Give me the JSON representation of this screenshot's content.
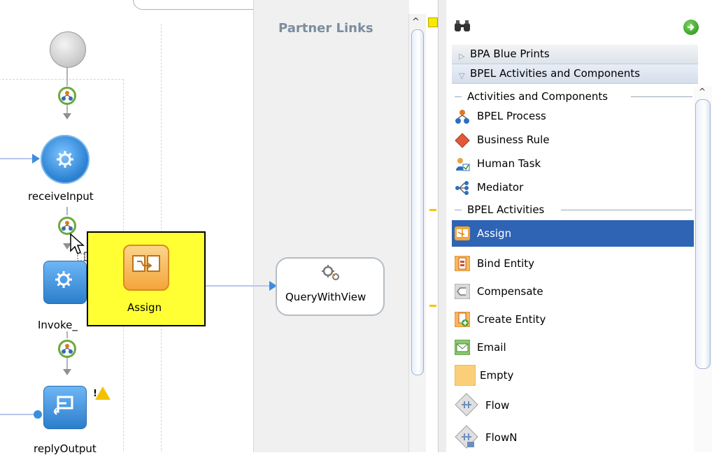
{
  "canvas": {
    "partner_links_title": "Partner Links",
    "nodes": {
      "receive_label": "receiveInput",
      "invoke_label": "Invoke_",
      "reply_label": "replyOutput",
      "query_label": "QueryWithView"
    },
    "drag_tooltip": {
      "label": "Assign"
    },
    "warning_mark": "!"
  },
  "palette": {
    "search": {
      "value": "",
      "placeholder": ""
    },
    "categories": [
      {
        "label": "BPA Blue Prints",
        "expanded": false
      },
      {
        "label": "BPEL Activities and Components",
        "expanded": true
      }
    ],
    "groups": [
      {
        "label": "Activities and Components",
        "items": [
          {
            "label": "BPEL Process",
            "icon": "bpel-process-icon"
          },
          {
            "label": "Business Rule",
            "icon": "business-rule-icon"
          },
          {
            "label": "Human Task",
            "icon": "human-task-icon"
          },
          {
            "label": "Mediator",
            "icon": "mediator-icon"
          }
        ]
      },
      {
        "label": "BPEL Activities",
        "items": [
          {
            "label": "Assign",
            "icon": "assign-icon",
            "selected": true
          },
          {
            "label": "Bind Entity",
            "icon": "bind-entity-icon"
          },
          {
            "label": "Compensate",
            "icon": "compensate-icon"
          },
          {
            "label": "Create Entity",
            "icon": "create-entity-icon"
          },
          {
            "label": "Email",
            "icon": "email-icon"
          },
          {
            "label": "Empty",
            "icon": "empty-icon"
          },
          {
            "label": "Flow",
            "icon": "flow-icon"
          },
          {
            "label": "FlowN",
            "icon": "flown-icon"
          }
        ]
      }
    ]
  },
  "colors": {
    "selection": "#2f64b5",
    "tooltip_bg": "#ffff33",
    "node_blue": "#2f86d6",
    "partner_title": "#7b8da0"
  }
}
